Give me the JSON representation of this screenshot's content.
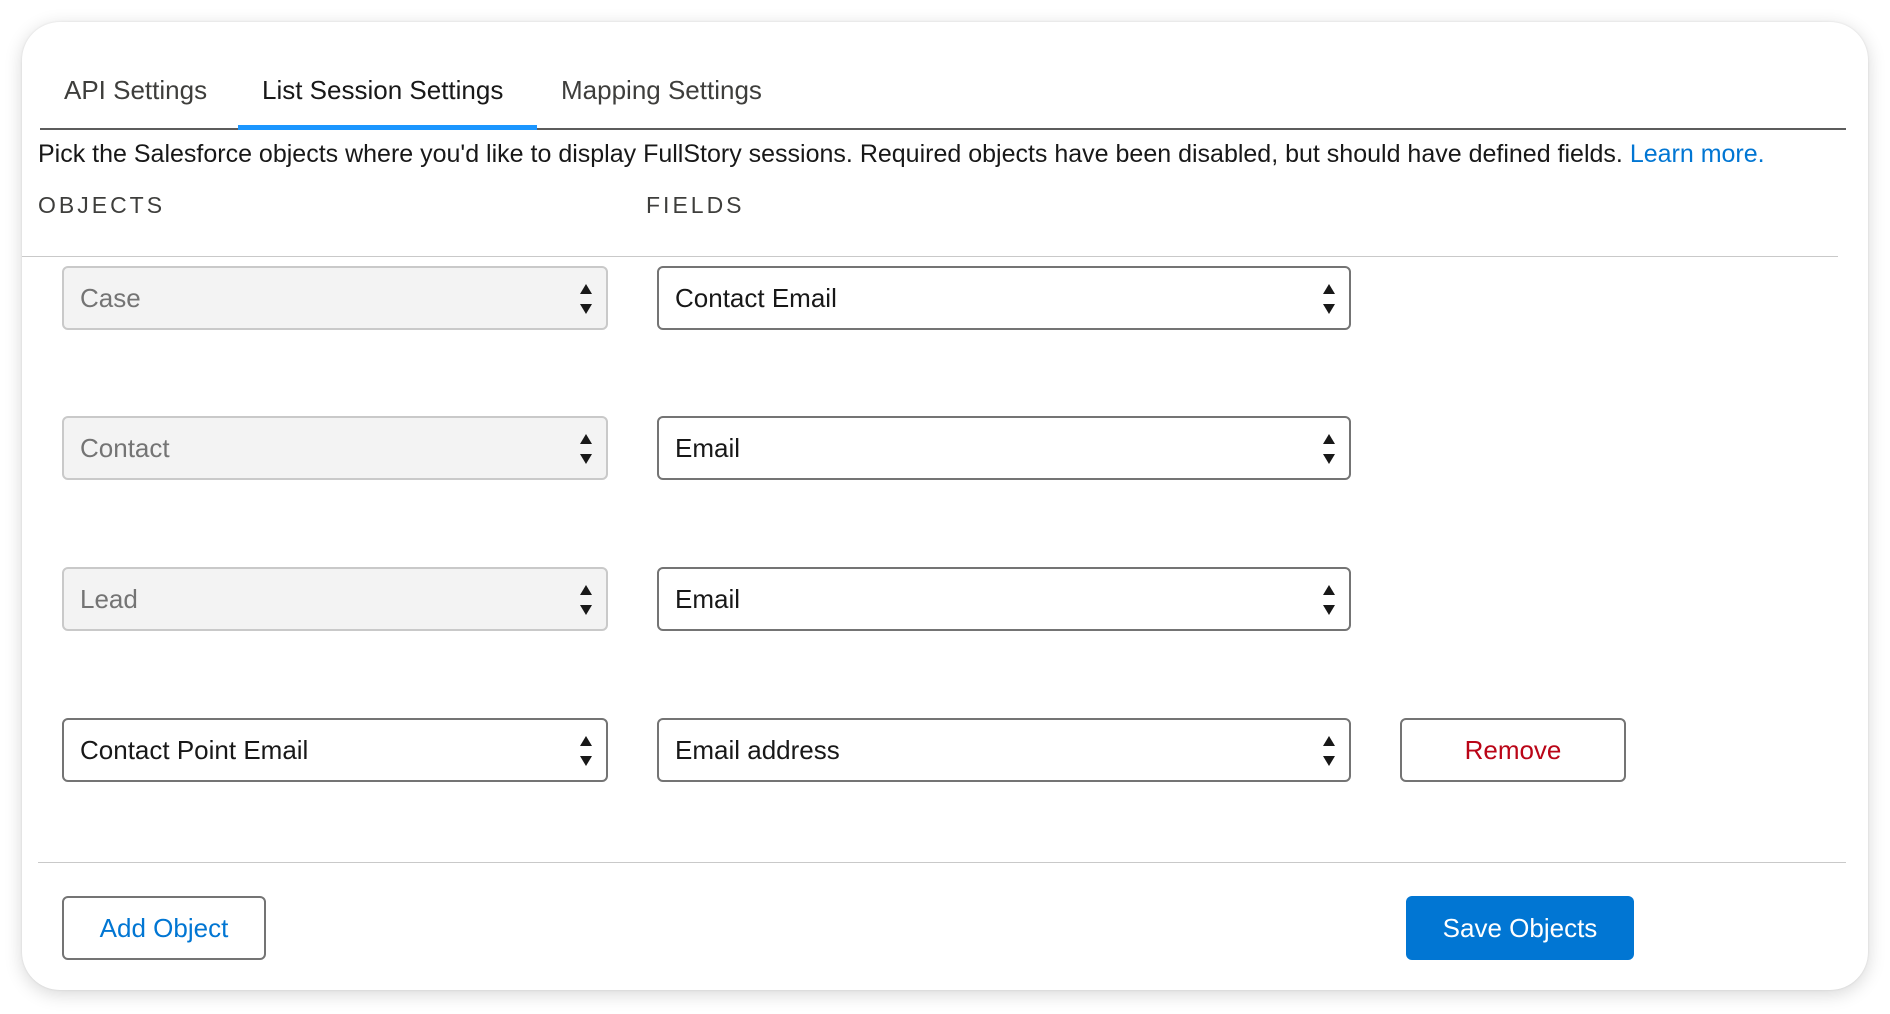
{
  "tabs": [
    {
      "label": "API Settings",
      "active": false
    },
    {
      "label": "List Session Settings",
      "active": true
    },
    {
      "label": "Mapping Settings",
      "active": false
    }
  ],
  "description": {
    "text": "Pick the Salesforce objects where you'd like to display FullStory sessions. Required objects have been disabled, but should have defined fields.",
    "link_text": "Learn more."
  },
  "columns": {
    "objects": "OBJECTS",
    "fields": "FIELDS"
  },
  "rows": [
    {
      "object": "Case",
      "field": "Contact Email",
      "object_disabled": true
    },
    {
      "object": "Contact",
      "field": "Email",
      "object_disabled": true
    },
    {
      "object": "Lead",
      "field": "Email",
      "object_disabled": true
    },
    {
      "object": "Contact Point Email",
      "field": "Email address",
      "object_disabled": false,
      "remove_label": "Remove"
    }
  ],
  "actions": {
    "add_label": "Add Object",
    "save_label": "Save Objects"
  },
  "colors": {
    "accent": "#0176d3",
    "tab_indicator": "#1b96ff",
    "destructive": "#ba0517"
  }
}
